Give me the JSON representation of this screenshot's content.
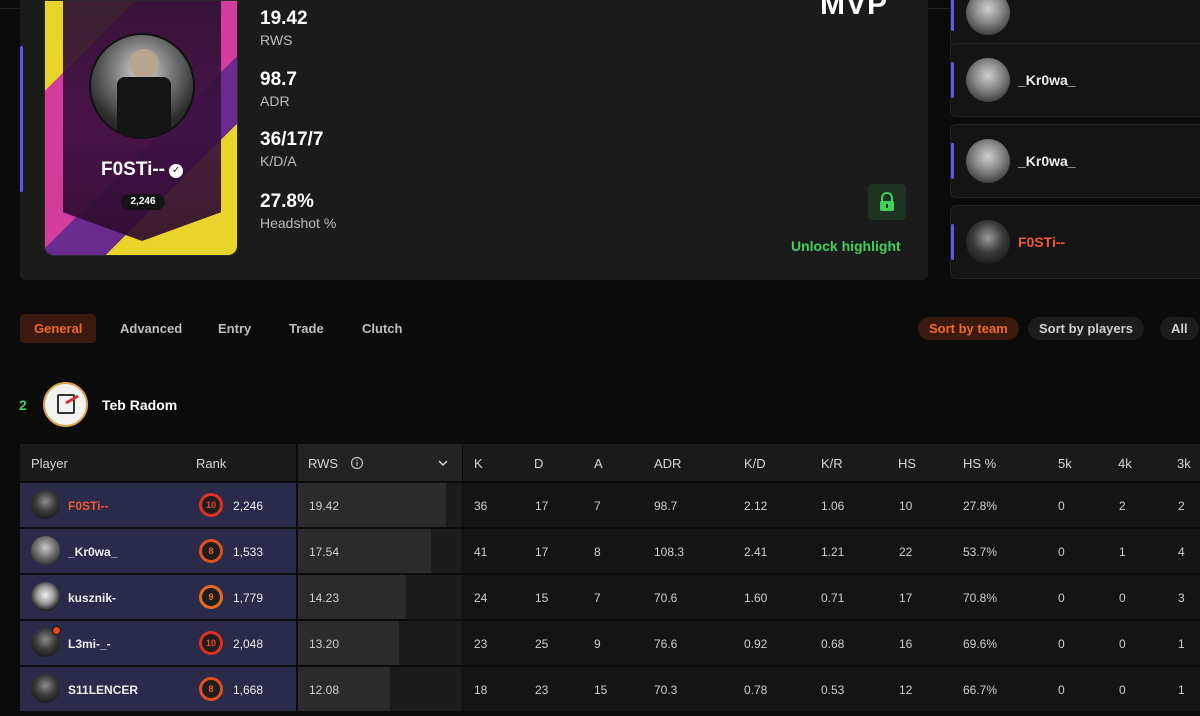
{
  "mvp": {
    "title": "MVP",
    "player_name": "F0STi--",
    "elo": "2,246",
    "stats": [
      {
        "value": "19.42",
        "label": "RWS"
      },
      {
        "value": "98.7",
        "label": "ADR"
      },
      {
        "value": "36/17/7",
        "label": "K/D/A"
      },
      {
        "value": "27.8%",
        "label": "Headshot %"
      }
    ],
    "unlock_label": "Unlock highlight"
  },
  "highlights": [
    {
      "name": "_Kr0wa_",
      "me": false
    },
    {
      "name": "_Kr0wa_",
      "me": false
    },
    {
      "name": "F0STi--",
      "me": true
    }
  ],
  "tabs": [
    "General",
    "Advanced",
    "Entry",
    "Trade",
    "Clutch"
  ],
  "sort": [
    "Sort by team",
    "Sort by players",
    "All"
  ],
  "team": {
    "rank": "2",
    "name": "Teb Radom"
  },
  "table": {
    "headers": {
      "player": "Player",
      "rank": "Rank",
      "rws": "RWS",
      "cols": [
        "K",
        "D",
        "A",
        "ADR",
        "K/D",
        "K/R",
        "HS",
        "HS %",
        "5k",
        "4k",
        "3k"
      ]
    },
    "rows": [
      {
        "name": "F0STi--",
        "me": true,
        "level": "10",
        "elo": "2,246",
        "rws": "19.42",
        "rws_pct": 1.0,
        "stats": [
          "36",
          "17",
          "7",
          "98.7",
          "2.12",
          "1.06",
          "10",
          "27.8%",
          "0",
          "2",
          "2"
        ]
      },
      {
        "name": "_Kr0wa_",
        "me": false,
        "level": "8",
        "elo": "1,533",
        "rws": "17.54",
        "rws_pct": 0.9,
        "stats": [
          "41",
          "17",
          "8",
          "108.3",
          "2.41",
          "1.21",
          "22",
          "53.7%",
          "0",
          "1",
          "4"
        ]
      },
      {
        "name": "kusznik-",
        "me": false,
        "level": "9",
        "elo": "1,779",
        "rws": "14.23",
        "rws_pct": 0.73,
        "stats": [
          "24",
          "15",
          "7",
          "70.6",
          "1.60",
          "0.71",
          "17",
          "70.8%",
          "0",
          "0",
          "3"
        ]
      },
      {
        "name": "L3mi-_-",
        "me": false,
        "level": "10",
        "elo": "2,048",
        "rws": "13.20",
        "rws_pct": 0.68,
        "stats": [
          "23",
          "25",
          "9",
          "76.6",
          "0.92",
          "0.68",
          "16",
          "69.6%",
          "0",
          "0",
          "1"
        ]
      },
      {
        "name": "S11LENCER",
        "me": false,
        "level": "8",
        "elo": "1,668",
        "rws": "12.08",
        "rws_pct": 0.62,
        "stats": [
          "18",
          "23",
          "15",
          "70.3",
          "0.78",
          "0.53",
          "12",
          "66.7%",
          "0",
          "0",
          "1"
        ]
      }
    ]
  }
}
